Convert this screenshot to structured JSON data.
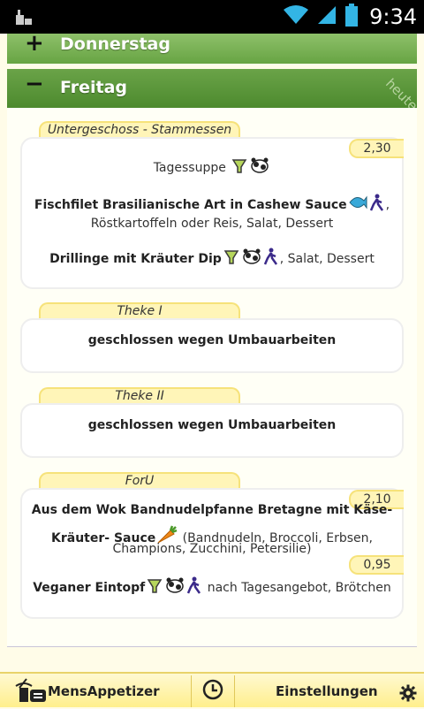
{
  "status_bar": {
    "time": "9:34",
    "icons": [
      "notification-icon",
      "wifi-icon",
      "signal-icon",
      "battery-icon"
    ]
  },
  "days": [
    {
      "sign": "+",
      "label": "Donnerstag",
      "expanded": false
    },
    {
      "sign": "−",
      "label": "Freitag",
      "expanded": true,
      "badge": "heute"
    }
  ],
  "sections": [
    {
      "name": "Untergeschoss - Stammessen",
      "price": "2,30",
      "meals": [
        {
          "title": "",
          "text": "Tagessuppe",
          "icons": [
            "veggie-icon",
            "cow-icon"
          ]
        },
        {
          "title": "Fischfilet Brasilianische Art in Cashew Sauce",
          "icons": [
            "fish-icon",
            "person-icon"
          ],
          "text": ", Röstkartoffeln oder Reis, Salat, Dessert"
        },
        {
          "title": "Drillinge mit Kräuter Dip",
          "icons": [
            "veggie-icon",
            "cow-icon",
            "person-icon"
          ],
          "text": ", Salat, Dessert"
        }
      ]
    },
    {
      "name": "Theke I",
      "meals": [
        {
          "title": "geschlossen wegen Umbauarbeiten"
        }
      ]
    },
    {
      "name": "Theke II",
      "meals": [
        {
          "title": "geschlossen wegen Umbauarbeiten"
        }
      ]
    },
    {
      "name": "ForU",
      "meals": [
        {
          "price": "2,10",
          "title_line1": "Aus dem Wok Bandnudelpfanne Bretagne mit Käse-",
          "title_line2": "Kräuter- Sauce",
          "icons": [
            "carrot-icon"
          ],
          "text_line2": " (Bandnudeln, Broccoli, Erbsen,",
          "text_line3": "Champions, Zucchini, Petersilie)"
        },
        {
          "price": "0,95",
          "title": "Veganer Eintopf",
          "icons": [
            "veggie-icon",
            "cow-icon",
            "person-icon"
          ],
          "text": " nach Tagesangebot, Brötchen"
        }
      ]
    }
  ],
  "bottom_bar": {
    "app_label": "MensAppetizer",
    "settings_label": "Einstellungen",
    "icons": [
      "app-logo-icon",
      "clock-icon",
      "gear-icon"
    ]
  }
}
